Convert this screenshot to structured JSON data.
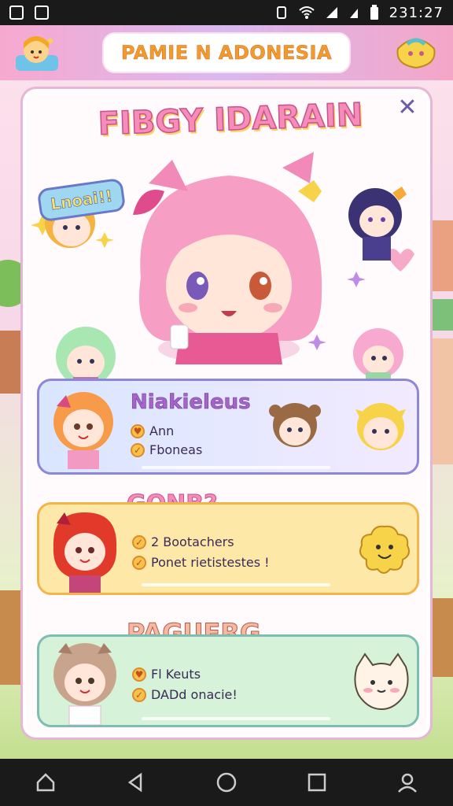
{
  "status_bar": {
    "time": "231:27",
    "left_icons": [
      "gallery-icon",
      "notification-icon"
    ],
    "right_icons": [
      "vibrate-icon",
      "wifi-icon",
      "signal-icon",
      "signal-2-icon",
      "battery-icon"
    ]
  },
  "header": {
    "title": "PAMIE N ADONESIA"
  },
  "panel": {
    "hero_title": "FIBGY IDARAIN",
    "hero_bubble": "Lnoai!!"
  },
  "cards": [
    {
      "title": "Niakieleus",
      "stats": [
        "Ann",
        "Fboneas"
      ]
    },
    {
      "title": "GONB?",
      "stats": [
        "2 Bootachers",
        "Ponet rietistestes !"
      ]
    },
    {
      "title": "PAGUERG",
      "stats": [
        "Fl Keuts",
        "DADd onacie!"
      ]
    }
  ],
  "navigation": {
    "buttons": [
      "home-icon",
      "back-icon",
      "circle-home-icon",
      "recents-icon",
      "profile-icon"
    ]
  },
  "colors": {
    "header_gradient_left": "#f7a9cf",
    "header_gradient_right": "#f4a6c7",
    "hero_title": "#f58cb9",
    "card1_border": "#8e86d8",
    "card2_border": "#f2b54a",
    "card3_border": "#7dbdb2"
  }
}
